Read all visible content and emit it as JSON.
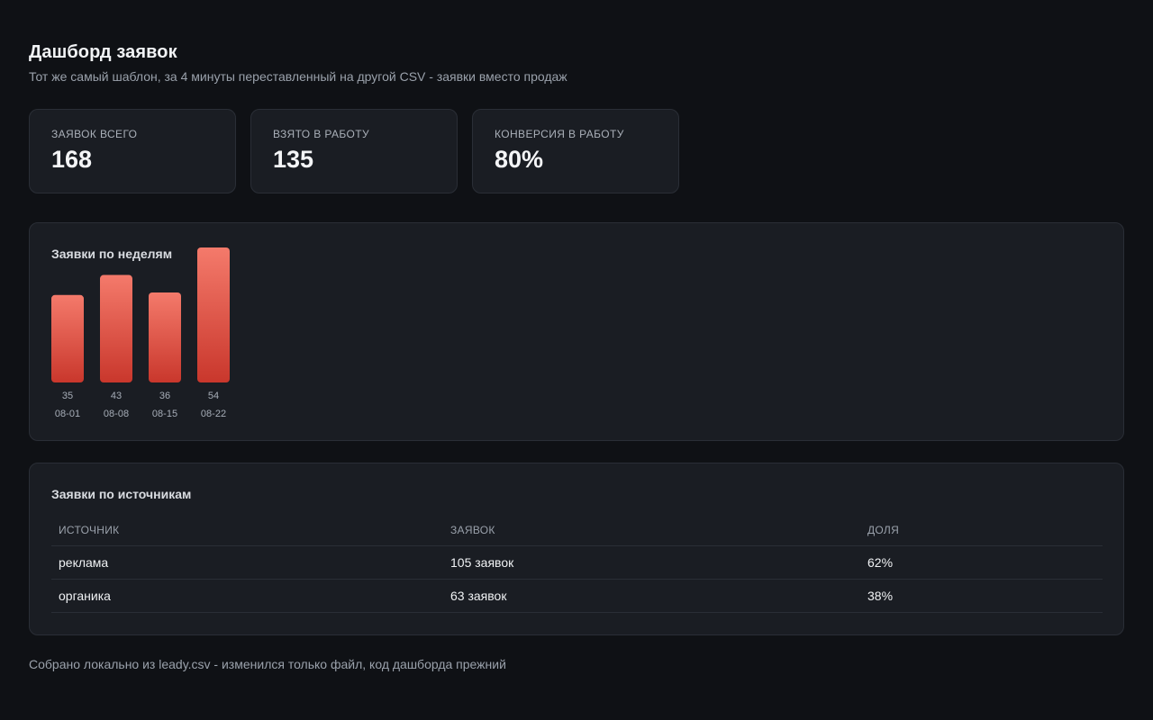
{
  "header": {
    "title": "Дашборд заявок",
    "subtitle": "Тот же самый шаблон, за 4 минуты переставленный на другой CSV - заявки вместо продаж"
  },
  "kpis": [
    {
      "label": "ЗАЯВОК ВСЕГО",
      "value": "168"
    },
    {
      "label": "ВЗЯТО В РАБОТУ",
      "value": "135"
    },
    {
      "label": "КОНВЕРСИЯ В РАБОТУ",
      "value": "80%"
    }
  ],
  "chart_panel": {
    "title": "Заявки по неделям"
  },
  "chart_data": {
    "type": "bar",
    "title": "Заявки по неделям",
    "categories": [
      "08-01",
      "08-08",
      "08-15",
      "08-22"
    ],
    "values": [
      35,
      43,
      36,
      54
    ],
    "data_labels": [
      "35",
      "43",
      "36",
      "54"
    ],
    "xlabel": "",
    "ylabel": "",
    "grid": false,
    "bar_gradient": [
      "#f47a6b",
      "#c9372c"
    ]
  },
  "table_panel": {
    "title": "Заявки по источникам",
    "columns": [
      "ИСТОЧНИК",
      "ЗАЯВОК",
      "ДОЛЯ"
    ],
    "rows": [
      [
        "реклама",
        "105 заявок",
        "62%"
      ],
      [
        "органика",
        "63 заявок",
        "38%"
      ]
    ]
  },
  "footer": {
    "text": "Собрано локально из leady.csv - изменился только файл, код дашборда прежний"
  },
  "colors": {
    "background": "#0f1115",
    "card": "#1a1d23",
    "border": "#2a2e36",
    "accent": "#e5554a"
  }
}
